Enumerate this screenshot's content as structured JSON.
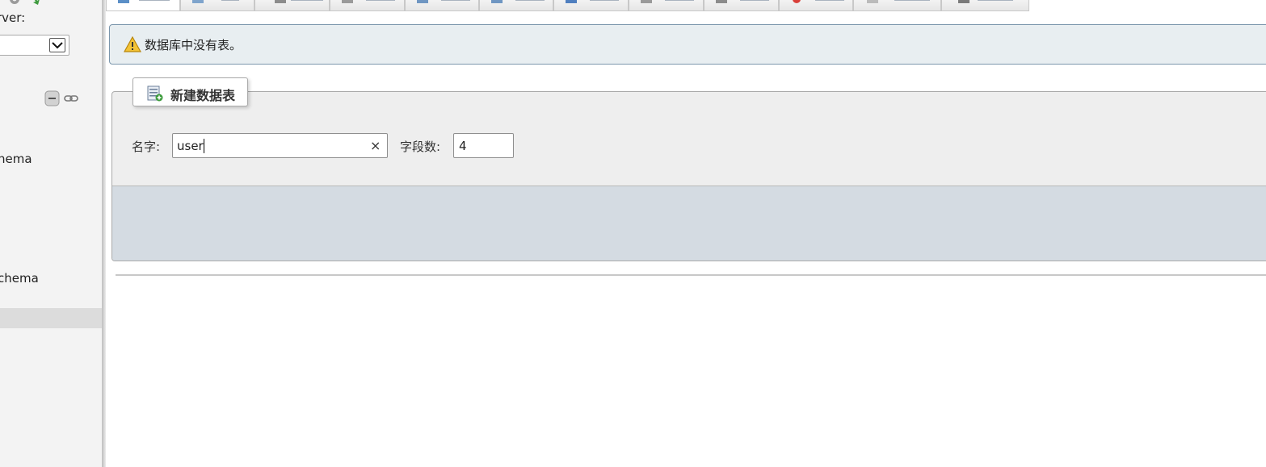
{
  "nav": {
    "server_label": "rver:",
    "databases": [
      {
        "label": "hema"
      },
      {
        "label": "chema"
      }
    ],
    "icons": [
      "settings-icon",
      "reload-icon",
      "collapse-all-icon",
      "link-icon"
    ]
  },
  "tabs": [
    {
      "icon": "structure-icon",
      "active": true
    },
    {
      "icon": "sql-icon"
    },
    {
      "icon": "search-icon"
    },
    {
      "icon": "query-icon"
    },
    {
      "icon": "export-icon"
    },
    {
      "icon": "import-icon"
    },
    {
      "icon": "operations-icon"
    },
    {
      "icon": "privileges-icon"
    },
    {
      "icon": "routines-icon"
    },
    {
      "icon": "events-icon"
    },
    {
      "icon": "triggers-icon"
    },
    {
      "icon": "designer-icon"
    }
  ],
  "notice": {
    "text": "数据库中没有表。",
    "icon": "warning-icon"
  },
  "create_table": {
    "legend": "新建数据表",
    "name_label": "名字:",
    "name_value": "user",
    "fields_label": "字段数:",
    "fields_value": "4",
    "clear_symbol": "×"
  },
  "colors": {
    "notice_bg": "#e8eef1",
    "notice_border": "#7b96ac",
    "fieldset_bg": "#eeeeee",
    "footer_bg": "#d4dbe2",
    "nav_bg": "#f3f3f3"
  }
}
